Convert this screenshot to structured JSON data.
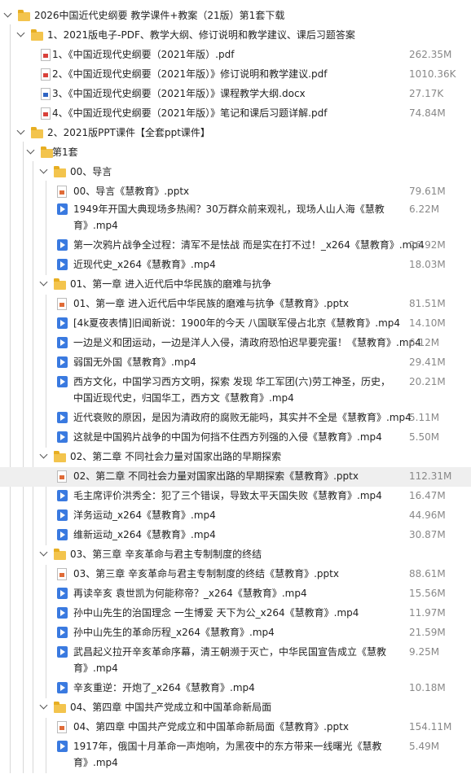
{
  "tree": {
    "items": [
      {
        "type": "folder",
        "level": 0,
        "label": "2026中国近代史纲要 教学课件+教案（21版）第1套下载",
        "size": ""
      },
      {
        "type": "folder",
        "level": 1,
        "label": "1、2021版电子-PDF、教学大纲、修订说明和教学建议、课后习题答案",
        "size": ""
      },
      {
        "type": "pdf",
        "level": 2,
        "label": "1、《中国近现代史纲要（2021年版）.pdf",
        "size": "262.35M"
      },
      {
        "type": "pdf",
        "level": 2,
        "label": "2、《中国近现代史纲要（2021年版）》修订说明和教学建议.pdf",
        "size": "1010.36K"
      },
      {
        "type": "docx",
        "level": 2,
        "label": "3、《中国近现代史纲要（2021年版）》课程教学大纲.docx",
        "size": "27.17K"
      },
      {
        "type": "pdf",
        "level": 2,
        "label": "4、《中国近现代史纲要（2021年版）》笔记和课后习题详解.pdf",
        "size": "74.84M"
      },
      {
        "type": "folder",
        "level": 1,
        "label": "2、2021版PPT课件【全套ppt课件】",
        "size": ""
      },
      {
        "type": "folder",
        "level": 2,
        "label": "第1套",
        "size": ""
      },
      {
        "type": "folder",
        "level": 3,
        "label": "00、导言",
        "size": ""
      },
      {
        "type": "pptx",
        "level": 4,
        "label": "00、导言《慧教育》.pptx",
        "size": "79.61M"
      },
      {
        "type": "video",
        "level": 4,
        "label": "1949年开国大典现场多热闹？30万群众前来观礼，现场人山人海《慧教育》.mp4",
        "size": "6.22M"
      },
      {
        "type": "video",
        "level": 4,
        "label": "第一次鸦片战争全过程：清军不是怯战 而是实在打不过！_x264《慧教育》.mp4",
        "size": "26.92M"
      },
      {
        "type": "video",
        "level": 4,
        "label": "近现代史_x264《慧教育》.mp4",
        "size": "18.03M"
      },
      {
        "type": "folder",
        "level": 3,
        "label": "01、第一章 进入近代后中华民族的磨难与抗争",
        "size": ""
      },
      {
        "type": "pptx",
        "level": 4,
        "label": "01、第一章 进入近代后中华民族的磨难与抗争《慧教育》.pptx",
        "size": "81.51M"
      },
      {
        "type": "video",
        "level": 4,
        "label": "[4k夏夜表情]旧闻新说：1900年的今天 八国联军侵占北京《慧教育》.mp4",
        "size": "14.10M"
      },
      {
        "type": "video",
        "level": 4,
        "label": "一边是义和团运动，一边是洋人入侵，清政府恐怕迟早要完蛋！《慧教育》.mp4",
        "size": "6.12M"
      },
      {
        "type": "video",
        "level": 4,
        "label": "弱国无外国《慧教育》.mp4",
        "size": "29.41M"
      },
      {
        "type": "video",
        "level": 4,
        "label": "西方文化，中国学习西方文明，探索 发现 华工军团(六)劳工神圣，历史，中国近现代史，归国华工，西方文《慧教育》.mp4",
        "size": "20.21M"
      },
      {
        "type": "video",
        "level": 4,
        "label": "近代衰败的原因，是因为清政府的腐败无能吗，其实并不全是《慧教育》.mp4",
        "size": "5.11M"
      },
      {
        "type": "video",
        "level": 4,
        "label": "这就是中国鸦片战争的中国为何挡不住西方列强的入侵《慧教育》.mp4",
        "size": "5.50M"
      },
      {
        "type": "folder",
        "level": 3,
        "label": "02、第二章 不同社会力量对国家出路的早期探索",
        "size": ""
      },
      {
        "type": "pptx",
        "level": 4,
        "label": "02、第二章 不同社会力量对国家出路的早期探索《慧教育》.pptx",
        "size": "112.31M"
      },
      {
        "type": "video",
        "level": 4,
        "label": "毛主席评价洪秀全：犯了三个错误，导致太平天国失败《慧教育》.mp4",
        "size": "16.47M"
      },
      {
        "type": "video",
        "level": 4,
        "label": "洋务运动_x264《慧教育》.mp4",
        "size": "44.96M"
      },
      {
        "type": "video",
        "level": 4,
        "label": "维新运动_x264《慧教育》.mp4",
        "size": "30.87M"
      },
      {
        "type": "folder",
        "level": 3,
        "label": "03、第三章 辛亥革命与君主专制制度的终结",
        "size": ""
      },
      {
        "type": "pptx",
        "level": 4,
        "label": "03、第三章 辛亥革命与君主专制制度的终结《慧教育》.pptx",
        "size": "88.61M"
      },
      {
        "type": "video",
        "level": 4,
        "label": "再读辛亥 袁世凯为何能称帝？_x264《慧教育》.mp4",
        "size": "15.56M"
      },
      {
        "type": "video",
        "level": 4,
        "label": "孙中山先生的治国理念 一生博爱 天下为公_x264《慧教育》.mp4",
        "size": "11.97M"
      },
      {
        "type": "video",
        "level": 4,
        "label": "孙中山先生的革命历程_x264《慧教育》.mp4",
        "size": "21.59M"
      },
      {
        "type": "video",
        "level": 4,
        "label": "武昌起义拉开辛亥革命序幕，清王朝濒于灭亡，中华民国宣告成立《慧教育》.mp4",
        "size": "9.25M"
      },
      {
        "type": "video",
        "level": 4,
        "label": "辛亥重逆：开炮了_x264《慧教育》.mp4",
        "size": "10.18M"
      },
      {
        "type": "folder",
        "level": 3,
        "label": "04、第四章 中国共产党成立和中国革命新局面",
        "size": ""
      },
      {
        "type": "pptx",
        "level": 4,
        "label": "04、第四章 中国共产党成立和中国革命新局面《慧教育》.pptx",
        "size": "154.11M"
      },
      {
        "type": "video",
        "level": 4,
        "label": "1917年，俄国十月革命一声炮响，为黑夜中的东方带来一线曙光《慧教育》.mp4",
        "size": "5.49M"
      }
    ]
  }
}
